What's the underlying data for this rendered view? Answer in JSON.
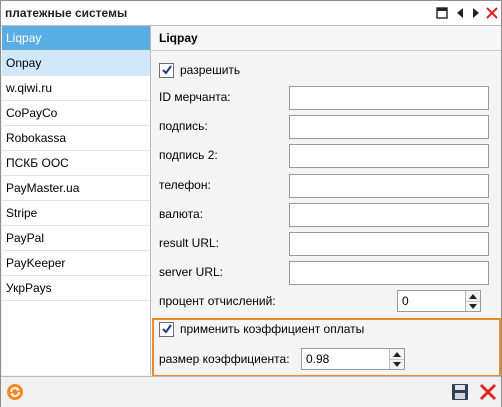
{
  "window": {
    "title": "платежные системы"
  },
  "sidebar": {
    "items": [
      {
        "label": "Liqpay"
      },
      {
        "label": "Onpay"
      },
      {
        "label": "w.qiwi.ru"
      },
      {
        "label": "CoPayCo"
      },
      {
        "label": "Robokassa"
      },
      {
        "label": "ПСКБ ООС"
      },
      {
        "label": "PayMaster.ua"
      },
      {
        "label": "Stripe"
      },
      {
        "label": "PayPal"
      },
      {
        "label": "PayKeeper"
      },
      {
        "label": "УкрPays"
      }
    ]
  },
  "main": {
    "heading": "Liqpay",
    "enable_label": "разрешить",
    "fields": [
      {
        "label": "ID мерчанта:",
        "value": ""
      },
      {
        "label": "подпись:",
        "value": ""
      },
      {
        "label": "подпись 2:",
        "value": ""
      },
      {
        "label": "телефон:",
        "value": ""
      },
      {
        "label": "валюта:",
        "value": ""
      },
      {
        "label": "result URL:",
        "value": ""
      },
      {
        "label": "server URL:",
        "value": ""
      }
    ],
    "percent_label": "процент отчислений:",
    "percent_value": "0",
    "apply_coef_label": "применить коэффициент оплаты",
    "coef_label": "размер коэффициента:",
    "coef_value": "0.98"
  },
  "colors": {
    "selected": "#5aaee6",
    "highlight": "#cfe8fb",
    "accent_box": "#f08a24",
    "close_red": "#e0231f"
  }
}
